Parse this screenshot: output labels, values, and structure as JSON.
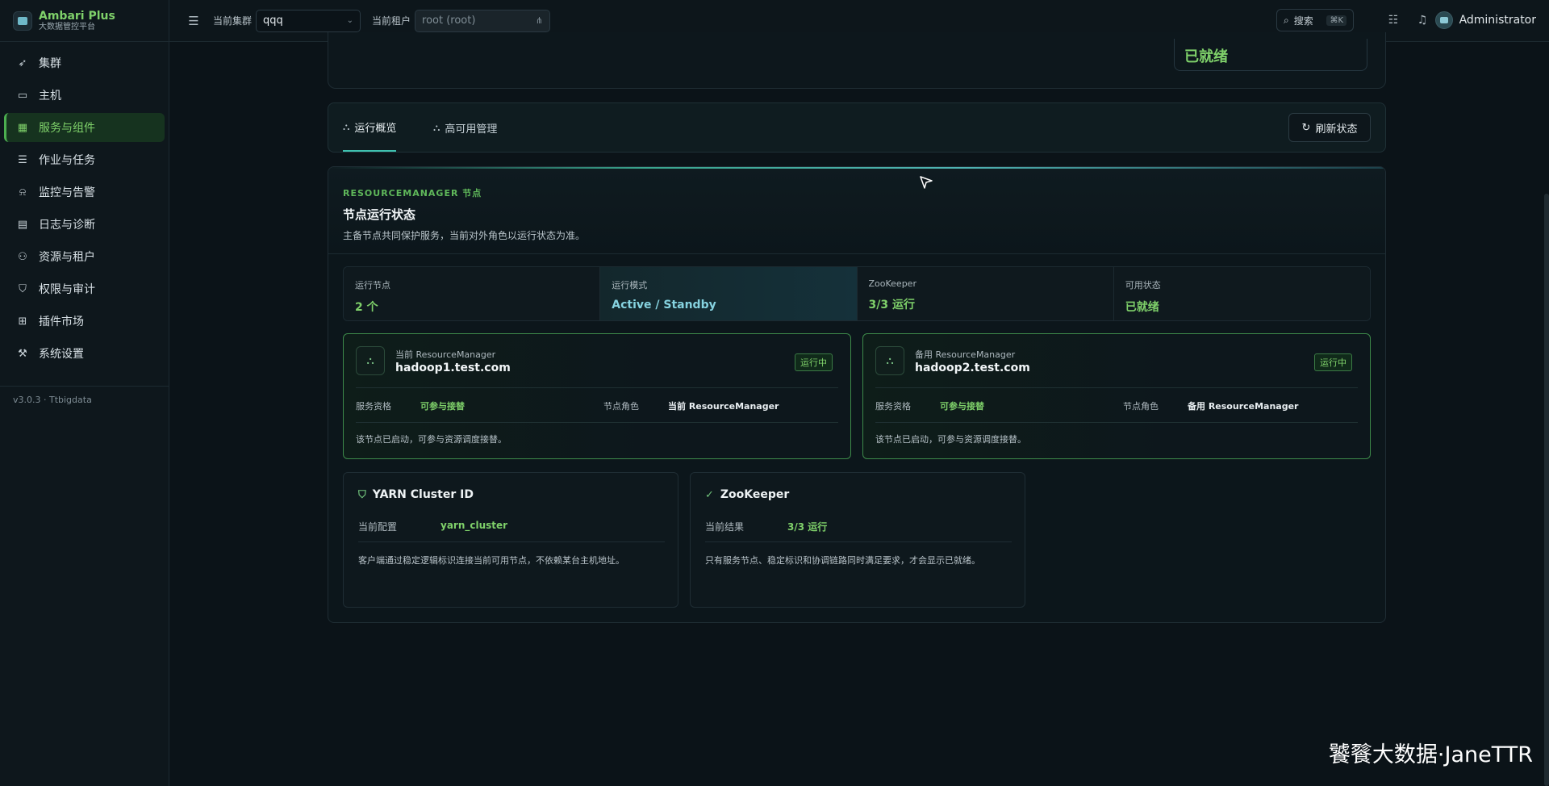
{
  "brand": {
    "name": "Ambari Plus",
    "subtitle": "大数据管控平台"
  },
  "sidebar": {
    "items": [
      {
        "label": "集群",
        "icon": "rocket-icon"
      },
      {
        "label": "主机",
        "icon": "monitor-icon"
      },
      {
        "label": "服务与组件",
        "icon": "grid-icon",
        "active": true
      },
      {
        "label": "作业与任务",
        "icon": "list-icon"
      },
      {
        "label": "监控与告警",
        "icon": "alarm-icon"
      },
      {
        "label": "日志与诊断",
        "icon": "log-icon"
      },
      {
        "label": "资源与租户",
        "icon": "users-icon"
      },
      {
        "label": "权限与审计",
        "icon": "shield-icon"
      },
      {
        "label": "插件市场",
        "icon": "plugin-icon"
      },
      {
        "label": "系统设置",
        "icon": "wrench-icon"
      }
    ],
    "version": "v3.0.3 · Ttbigdata"
  },
  "header": {
    "cluster_label": "当前集群",
    "cluster_value": "qqq",
    "tenant_label": "当前租户",
    "tenant_value": "root (root)",
    "search_label": "搜索",
    "search_shortcut": "⌘K",
    "user_name": "Administrator"
  },
  "top_card": {
    "status": "已就绪"
  },
  "tabs": {
    "items": [
      {
        "label": "运行概览",
        "active": true
      },
      {
        "label": "高可用管理",
        "active": false
      }
    ],
    "refresh_label": "刷新状态"
  },
  "panel": {
    "eyebrow": "RESOURCEMANAGER 节点",
    "title": "节点运行状态",
    "description": "主备节点共同保护服务，当前对外角色以运行状态为准。",
    "stats": [
      {
        "label": "运行节点",
        "value": "2 个"
      },
      {
        "label": "运行模式",
        "value": "Active / Standby"
      },
      {
        "label": "ZooKeeper",
        "value": "3/3 运行"
      },
      {
        "label": "可用状态",
        "value": "已就绪"
      }
    ],
    "nodes": [
      {
        "subtitle": "当前 ResourceManager",
        "host": "hadoop1.test.com",
        "badge": "运行中",
        "eligibility_label": "服务资格",
        "eligibility_value": "可参与接替",
        "role_label": "节点角色",
        "role_value": "当前 ResourceManager",
        "note": "该节点已启动，可参与资源调度接替。"
      },
      {
        "subtitle": "备用 ResourceManager",
        "host": "hadoop2.test.com",
        "badge": "运行中",
        "eligibility_label": "服务资格",
        "eligibility_value": "可参与接替",
        "role_label": "节点角色",
        "role_value": "备用 ResourceManager",
        "note": "该节点已启动，可参与资源调度接替。"
      }
    ],
    "info": [
      {
        "title": "YARN Cluster ID",
        "label": "当前配置",
        "value": "yarn_cluster",
        "note": "客户端通过稳定逻辑标识连接当前可用节点，不依赖某台主机地址。"
      },
      {
        "title": "ZooKeeper",
        "label": "当前结果",
        "value": "3/3 运行",
        "note": "只有服务节点、稳定标识和协调链路同时满足要求，才会显示已就绪。"
      }
    ]
  },
  "watermark": "饕餮大数据·JaneTTR",
  "colors": {
    "accent_green": "#7fd16a",
    "accent_teal": "#3fbfae",
    "background": "#0b1318"
  }
}
